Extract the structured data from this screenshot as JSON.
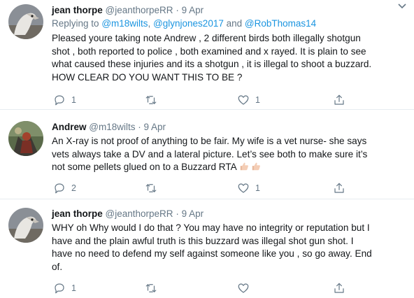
{
  "tweets": [
    {
      "name": "jean thorpe",
      "handle": "@jeanthorpeRR",
      "separator": "·",
      "time": "9 Apr",
      "replying_prefix": "Replying to",
      "replying_to": [
        "@m18wilts",
        "@glynjones2017",
        "@RobThomas14"
      ],
      "replying_joiner": ",",
      "replying_and": "and",
      "text_lines": [
        "Pleased youre taking note Andrew , 2 different birds both illegally shotgun",
        "shot , both reported to police , both examined and x rayed. It is plain to see",
        "what caused these injuries and its a shotgun , it is illegal to shoot a buzzard.",
        "HOW CLEAR DO YOU WANT THIS TO BE ?"
      ],
      "actions": {
        "reply_count": "1",
        "retweet_count": "",
        "like_count": "1"
      },
      "icons": [
        "reply-icon",
        "retweet-icon",
        "like-icon",
        "share-icon"
      ]
    },
    {
      "name": "Andrew",
      "handle": "@m18wilts",
      "separator": "·",
      "time": "9 Apr",
      "text_lines": [
        "An X-ray is not proof of anything to be fair. My wife is a vet nurse- she says",
        "vets always take a DV and a lateral picture. Let’s see both to make sure it’s",
        "not some pellets glued on to a Buzzard RTA"
      ],
      "emoji": [
        "thumbs-up-icon",
        "thumbs-up-icon"
      ],
      "actions": {
        "reply_count": "2",
        "retweet_count": "",
        "like_count": "1"
      }
    },
    {
      "name": "jean thorpe",
      "handle": "@jeanthorpeRR",
      "separator": "·",
      "time": "9 Apr",
      "text_lines": [
        "WHY oh Why would I do that ? You may have no integrity or reputation but I",
        "have and the plain awful truth is this buzzard was illegal shot gun shot. I",
        "have no need to defend my self against someone like you , so go away. End",
        "of."
      ],
      "actions": {
        "reply_count": "1",
        "retweet_count": "",
        "like_count": ""
      }
    }
  ],
  "colors": {
    "link": "#1b95e0",
    "secondary_text": "#657786",
    "primary_text": "#14171a",
    "divider": "#e6ecf0"
  }
}
